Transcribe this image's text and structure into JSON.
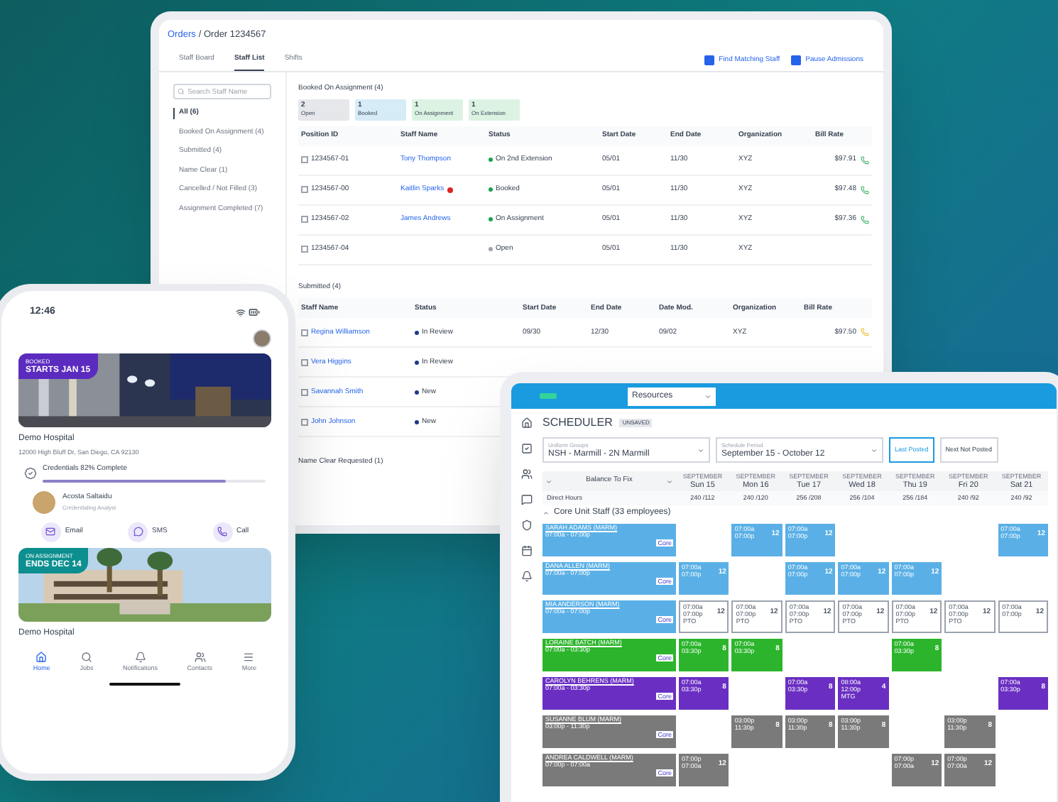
{
  "laptop": {
    "breadcrumb": {
      "link": "Orders",
      "current": "/ Order 1234567"
    },
    "tabs": [
      {
        "label": "Staff Board",
        "selected": false
      },
      {
        "label": "Staff List",
        "selected": true
      },
      {
        "label": "Shifts",
        "selected": false
      }
    ],
    "actions": [
      "Find Matching Staff",
      "Pause Admissions"
    ],
    "search": {
      "placeholder": "Search Staff Name"
    },
    "filters": [
      {
        "label": "All (6)",
        "selected": true
      },
      {
        "label": "Booked On Assignment (4)",
        "selected": false
      },
      {
        "label": "Submitted (4)",
        "selected": false
      },
      {
        "label": "Name Clear (1)",
        "selected": false
      },
      {
        "label": "Cancelled / Not Filled (3)",
        "selected": false
      },
      {
        "label": "Assignment Completed (7)",
        "selected": false
      }
    ],
    "booked": {
      "title": "Booked On Assignment (4)",
      "tiles": [
        {
          "count": "2",
          "label": "Open",
          "color": "#e5e7eb"
        },
        {
          "count": "1",
          "label": "Booked",
          "color": "#d6ecf7"
        },
        {
          "count": "1",
          "label": "On Assignment",
          "color": "#dcf3e3"
        },
        {
          "count": "1",
          "label": "On Extension",
          "color": "#dcf3e3"
        }
      ],
      "columns": [
        "Position ID",
        "Staff Name",
        "Status",
        "Start Date",
        "End Date",
        "Organization",
        "Bill Rate"
      ],
      "rows": [
        {
          "checked": false,
          "id": "1234567-01",
          "name": "Tony Thompson",
          "alert": false,
          "status": "On 2nd Extension",
          "color": "#16a34a",
          "start": "05/01",
          "end": "11/30",
          "org": "XYZ",
          "rate": "$97.91",
          "phone": true
        },
        {
          "checked": false,
          "id": "1234567-00",
          "name": "Kaitlin Sparks",
          "alert": true,
          "status": "Booked",
          "color": "#16a34a",
          "start": "05/01",
          "end": "11/30",
          "org": "XYZ",
          "rate": "$97.48",
          "phone": true
        },
        {
          "checked": false,
          "id": "1234567-02",
          "name": "James Andrews",
          "alert": false,
          "status": "On Assignment",
          "color": "#16a34a",
          "start": "05/01",
          "end": "11/30",
          "org": "XYZ",
          "rate": "$97.36",
          "phone": true
        },
        {
          "checked": false,
          "id": "1234567-04",
          "alert": false,
          "status": "Open",
          "color": "#9ca3af",
          "start": "05/01",
          "end": "11/30",
          "org": "XYZ",
          "phone": false
        }
      ]
    },
    "submitted": {
      "title": "Submitted (4)",
      "columns": [
        "Staff Name",
        "Status",
        "Start Date",
        "End Date",
        "Date Mod.",
        "Organization",
        "Bill Rate"
      ],
      "rows": [
        {
          "checked": false,
          "name": "Regina Williamson",
          "status": "In Review",
          "color": "#1e3a8a",
          "start": "09/30",
          "end": "12/30",
          "mod": "09/02",
          "org": "XYZ",
          "rate": "$97.50",
          "phone": true
        },
        {
          "checked": false,
          "name": "Vera Higgins",
          "status": "In Review",
          "color": "#1e3a8a",
          "phone": false
        },
        {
          "checked": false,
          "name": "Savannah Smith",
          "status": "New",
          "color": "#1e3a8a"
        },
        {
          "checked": false,
          "name": "John Johnson",
          "status": "New",
          "color": "#1e3a8a"
        }
      ]
    },
    "footer_section": "Name Clear Requested (1)"
  },
  "phone": {
    "time": "12:46",
    "cards": [
      {
        "tag_top": "BOOKED",
        "tag": "STARTS JAN 15",
        "color": "#5b2bc0",
        "name": "Demo Hospital",
        "address": "12000 High Bluff Dr, San Diego, CA 92130",
        "progress": {
          "label": "Credentials 82% Complete",
          "level": 0.82
        },
        "contact": {
          "name": "Acosta Saltaidu",
          "role": "Credentialing Analyst"
        },
        "actions": [
          "Email",
          "SMS",
          "Call"
        ]
      },
      {
        "tag_top": "ON ASSIGNMENT",
        "tag": "ENDS DEC 14",
        "color": "#0d8f8f",
        "name": "Demo Hospital"
      }
    ],
    "tabbar": [
      {
        "label": "Home",
        "selected": true
      },
      {
        "label": "Jobs",
        "selected": false
      },
      {
        "label": "Notifications",
        "selected": false
      },
      {
        "label": "Contacts",
        "selected": false
      },
      {
        "label": "More",
        "selected": false
      }
    ]
  },
  "tablet": {
    "resource_select": "Resources",
    "title": "SCHEDULER",
    "title_badge": "UNSAVED",
    "fields": [
      {
        "label": "Uniform Groups",
        "value": "NSH - Marmill - 2N Marmill"
      },
      {
        "label": "Schedule Period",
        "value": "September 15 - October 12"
      }
    ],
    "buttons": [
      {
        "label": "Last Posted",
        "selected": true
      },
      {
        "label": "Next Not Posted",
        "selected": false
      }
    ],
    "balance": "Balance To Fix",
    "days": [
      {
        "month": "SEPTEMBER",
        "day": "Sun 15",
        "hours": "240 /112"
      },
      {
        "month": "SEPTEMBER",
        "day": "Mon 16",
        "hours": "240 /120"
      },
      {
        "month": "SEPTEMBER",
        "day": "Tue 17",
        "hours": "256 /208"
      },
      {
        "month": "SEPTEMBER",
        "day": "Wed 18",
        "hours": "256 /104"
      },
      {
        "month": "SEPTEMBER",
        "day": "Thu 19",
        "hours": "256 /184"
      },
      {
        "month": "SEPTEMBER",
        "day": "Fri 20",
        "hours": "240 /92"
      },
      {
        "month": "SEPTEMBER",
        "day": "Sat 21",
        "hours": "240 /92"
      }
    ],
    "row_label": "Direct Hours",
    "group": "Core Unit Staff (33 employees)",
    "staff": [
      {
        "name": "SARAH ADAMS (MARM)",
        "shift": "07:00a - 07:00p",
        "tag": "Core",
        "color": "#5ab0e6",
        "kind": "filled",
        "shifts": [
          {
            "kind": "blank"
          },
          {
            "kind": "shift",
            "time": "07:00a",
            "end": "07:00p",
            "hours": "12"
          },
          {
            "kind": "shift",
            "time": "07:00a",
            "end": "07:00p",
            "hours": "12"
          },
          {
            "kind": "blank"
          },
          {
            "kind": "blank"
          },
          {
            "kind": "blank"
          },
          {
            "kind": "shift",
            "time": "07:00a",
            "end": "07:00p",
            "hours": "12"
          }
        ]
      },
      {
        "name": "DANA ALLEN (MARM)",
        "shift": "07:00a - 07:00p",
        "tag": "Core",
        "color": "#5ab0e6",
        "kind": "filled",
        "shifts": [
          {
            "kind": "shift",
            "time": "07:00a",
            "end": "07:00p",
            "hours": "12"
          },
          {
            "kind": "blank"
          },
          {
            "kind": "shift",
            "time": "07:00a",
            "end": "07:00p",
            "hours": "12"
          },
          {
            "kind": "shift",
            "time": "07:00a",
            "end": "07:00p",
            "hours": "12"
          },
          {
            "kind": "shift",
            "time": "07:00a",
            "end": "07:00p",
            "hours": "12"
          },
          {
            "kind": "blank"
          },
          {
            "kind": "blank"
          }
        ]
      },
      {
        "name": "MIA ANDERSON (MARM)",
        "shift": "07:00a - 07:00p",
        "tag": "Core",
        "color": "#5ab0e6",
        "kind": "outline",
        "shifts": [
          {
            "kind": "shift",
            "time": "07:00a",
            "end": "07:00p",
            "hours": "12",
            "note": "PTO"
          },
          {
            "kind": "shift",
            "time": "07:00a",
            "end": "07:00p",
            "hours": "12",
            "note": "PTO"
          },
          {
            "kind": "shift",
            "time": "07:00a",
            "end": "07:00p",
            "hours": "12",
            "note": "PTO"
          },
          {
            "kind": "shift",
            "time": "07:00a",
            "end": "07:00p",
            "hours": "12",
            "note": "PTO"
          },
          {
            "kind": "shift",
            "time": "07:00a",
            "end": "07:00p",
            "hours": "12",
            "note": "PTO"
          },
          {
            "kind": "shift",
            "time": "07:00a",
            "end": "07:00p",
            "hours": "12",
            "note": "PTO"
          },
          {
            "kind": "shift",
            "time": "07:00a",
            "end": "07:00p",
            "hours": "12"
          }
        ]
      },
      {
        "name": "LORAINE BATCH (MARM)",
        "shift": "07:00a - 03:30p",
        "tag": "Core",
        "color": "#2cb52c",
        "kind": "filled",
        "shifts": [
          {
            "kind": "shift",
            "time": "07:00a",
            "end": "03:30p",
            "hours": "8"
          },
          {
            "kind": "shift",
            "time": "07:00a",
            "end": "03:30p",
            "hours": "8"
          },
          {
            "kind": "blank"
          },
          {
            "kind": "blank"
          },
          {
            "kind": "shift",
            "time": "07:00a",
            "end": "03:30p",
            "hours": "8"
          },
          {
            "kind": "blank"
          },
          {
            "kind": "blank"
          }
        ]
      },
      {
        "name": "CAROLYN BEHRENS (MARM)",
        "shift": "07:00a - 03:30p",
        "tag": "Core",
        "color": "#6a2fc2",
        "kind": "filled",
        "shifts": [
          {
            "kind": "shift",
            "time": "07:00a",
            "end": "03:30p",
            "hours": "8"
          },
          {
            "kind": "blank"
          },
          {
            "kind": "shift",
            "time": "07:00a",
            "end": "03:30p",
            "hours": "8"
          },
          {
            "kind": "shift",
            "time": "08:00a",
            "end": "12:00p",
            "hours": "4",
            "note": "MTG"
          },
          {
            "kind": "blank"
          },
          {
            "kind": "blank"
          },
          {
            "kind": "shift",
            "time": "07:00a",
            "end": "03:30p",
            "hours": "8"
          }
        ]
      },
      {
        "name": "SUSANNE BLUM (MARM)",
        "shift": "03:00p - 11:30p",
        "tag": "Core",
        "color": "#7a7a7a",
        "kind": "filled",
        "shifts": [
          {
            "kind": "blank"
          },
          {
            "kind": "shift",
            "time": "03:00p",
            "end": "11:30p",
            "hours": "8"
          },
          {
            "kind": "shift",
            "time": "03:00p",
            "end": "11:30p",
            "hours": "8"
          },
          {
            "kind": "shift",
            "time": "03:00p",
            "end": "11:30p",
            "hours": "8"
          },
          {
            "kind": "blank"
          },
          {
            "kind": "shift",
            "time": "03:00p",
            "end": "11:30p",
            "hours": "8"
          },
          {
            "kind": "blank"
          }
        ]
      },
      {
        "name": "ANDREA CALDWELL (MARM)",
        "shift": "07:00p - 07:00a",
        "tag": "Core",
        "color": "#7a7a7a",
        "kind": "filled",
        "shifts": [
          {
            "kind": "shift",
            "time": "07:00p",
            "end": "07:00a",
            "hours": "12"
          },
          {
            "kind": "blank"
          },
          {
            "kind": "blank"
          },
          {
            "kind": "blank"
          },
          {
            "kind": "shift",
            "time": "07:00p",
            "end": "07:00a",
            "hours": "12"
          },
          {
            "kind": "shift",
            "time": "07:00p",
            "end": "07:00a",
            "hours": "12"
          },
          {
            "kind": "blank"
          }
        ]
      }
    ]
  }
}
